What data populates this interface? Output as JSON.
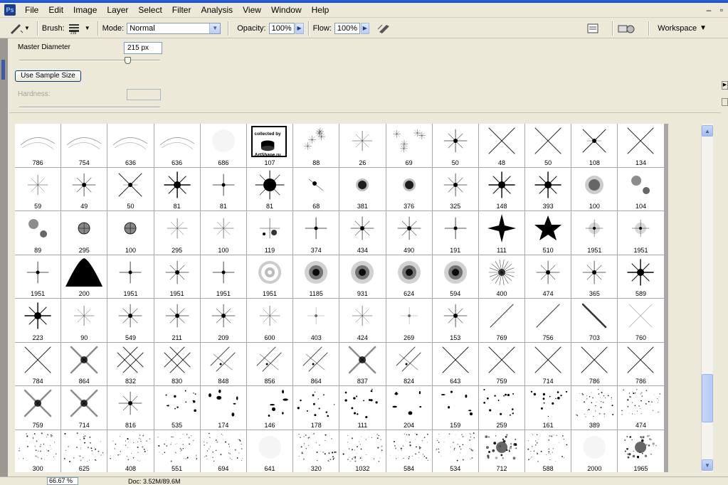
{
  "menu": {
    "items": [
      "File",
      "Edit",
      "Image",
      "Layer",
      "Select",
      "Filter",
      "Analysis",
      "View",
      "Window",
      "Help"
    ]
  },
  "window_controls": {
    "minimize": "–",
    "restore": "▫"
  },
  "options": {
    "brush_label": "Brush:",
    "mode_label": "Mode:",
    "mode_value": "Normal",
    "opacity_label": "Opacity:",
    "opacity_value": "100%",
    "flow_label": "Flow:",
    "flow_value": "100%",
    "workspace_label": "Workspace"
  },
  "panel": {
    "master_diameter_label": "Master Diameter",
    "master_diameter_value": "215 px",
    "master_diameter_slider": 0.77,
    "sample_button": "Use Sample Size",
    "hardness_label": "Hardness:",
    "badge_text": "collected by ArtShape.ru"
  },
  "brushes": [
    {
      "n": "786",
      "k": "wisp"
    },
    {
      "n": "754",
      "k": "wisp"
    },
    {
      "n": "636",
      "k": "wisp"
    },
    {
      "n": "636",
      "k": "wisp"
    },
    {
      "n": "686",
      "k": "faint"
    },
    {
      "n": "107",
      "k": "badge"
    },
    {
      "n": "88",
      "k": "multistar"
    },
    {
      "n": "26",
      "k": "thinstar"
    },
    {
      "n": "69",
      "k": "multistar"
    },
    {
      "n": "50",
      "k": "star"
    },
    {
      "n": "48",
      "k": "x"
    },
    {
      "n": "50",
      "k": "x"
    },
    {
      "n": "108",
      "k": "xstar"
    },
    {
      "n": "134",
      "k": "x"
    },
    {
      "n": "59",
      "k": "thinstar"
    },
    {
      "n": "49",
      "k": "star"
    },
    {
      "n": "50",
      "k": "xstar"
    },
    {
      "n": "81",
      "k": "boldstar"
    },
    {
      "n": "81",
      "k": "star4"
    },
    {
      "n": "81",
      "k": "burst"
    },
    {
      "n": "68",
      "k": "comet"
    },
    {
      "n": "381",
      "k": "glow"
    },
    {
      "n": "376",
      "k": "glow"
    },
    {
      "n": "325",
      "k": "star"
    },
    {
      "n": "148",
      "k": "boldstar"
    },
    {
      "n": "393",
      "k": "boldstar"
    },
    {
      "n": "100",
      "k": "softglow"
    },
    {
      "n": "104",
      "k": "twoglow"
    },
    {
      "n": "89",
      "k": "twoglow"
    },
    {
      "n": "295",
      "k": "circle"
    },
    {
      "n": "100",
      "k": "circle"
    },
    {
      "n": "295",
      "k": "thinstar"
    },
    {
      "n": "100",
      "k": "thinstar"
    },
    {
      "n": "119",
      "k": "clusterstar"
    },
    {
      "n": "374",
      "k": "star4"
    },
    {
      "n": "434",
      "k": "star"
    },
    {
      "n": "490",
      "k": "star"
    },
    {
      "n": "191",
      "k": "star4"
    },
    {
      "n": "111",
      "k": "fourpoint"
    },
    {
      "n": "510",
      "k": "pentagram"
    },
    {
      "n": "1951",
      "k": "ringstar"
    },
    {
      "n": "1951",
      "k": "ringstar"
    },
    {
      "n": "1951",
      "k": "star4"
    },
    {
      "n": "200",
      "k": "bell"
    },
    {
      "n": "1951",
      "k": "star4"
    },
    {
      "n": "1951",
      "k": "star"
    },
    {
      "n": "1951",
      "k": "star4"
    },
    {
      "n": "1951",
      "k": "ring"
    },
    {
      "n": "1185",
      "k": "fuzzy"
    },
    {
      "n": "931",
      "k": "fuzzy"
    },
    {
      "n": "624",
      "k": "fuzzy"
    },
    {
      "n": "594",
      "k": "fuzzy"
    },
    {
      "n": "400",
      "k": "spiky"
    },
    {
      "n": "474",
      "k": "star"
    },
    {
      "n": "365",
      "k": "star"
    },
    {
      "n": "589",
      "k": "boldstar"
    },
    {
      "n": "223",
      "k": "boldstar"
    },
    {
      "n": "90",
      "k": "thinstar"
    },
    {
      "n": "549",
      "k": "star"
    },
    {
      "n": "211",
      "k": "star"
    },
    {
      "n": "209",
      "k": "star"
    },
    {
      "n": "600",
      "k": "thinstar"
    },
    {
      "n": "403",
      "k": "faintstar"
    },
    {
      "n": "424",
      "k": "thinstar"
    },
    {
      "n": "269",
      "k": "faintstar"
    },
    {
      "n": "153",
      "k": "star"
    },
    {
      "n": "769",
      "k": "slash"
    },
    {
      "n": "756",
      "k": "slash"
    },
    {
      "n": "703",
      "k": "bslash"
    },
    {
      "n": "760",
      "k": "faintx"
    },
    {
      "n": "784",
      "k": "x"
    },
    {
      "n": "864",
      "k": "fuzzyx"
    },
    {
      "n": "832",
      "k": "hashx"
    },
    {
      "n": "830",
      "k": "hashx"
    },
    {
      "n": "848",
      "k": "hash"
    },
    {
      "n": "856",
      "k": "hash"
    },
    {
      "n": "864",
      "k": "hash"
    },
    {
      "n": "837",
      "k": "fuzzyx"
    },
    {
      "n": "824",
      "k": "hash"
    },
    {
      "n": "643",
      "k": "x"
    },
    {
      "n": "759",
      "k": "x"
    },
    {
      "n": "714",
      "k": "x"
    },
    {
      "n": "786",
      "k": "x"
    },
    {
      "n": "786",
      "k": "x"
    },
    {
      "n": "759",
      "k": "fuzzyx"
    },
    {
      "n": "714",
      "k": "fuzzyx"
    },
    {
      "n": "816",
      "k": "star"
    },
    {
      "n": "535",
      "k": "dots"
    },
    {
      "n": "174",
      "k": "splats"
    },
    {
      "n": "146",
      "k": "splats"
    },
    {
      "n": "178",
      "k": "dots"
    },
    {
      "n": "111",
      "k": "dots"
    },
    {
      "n": "204",
      "k": "splats"
    },
    {
      "n": "159",
      "k": "splats"
    },
    {
      "n": "259",
      "k": "dots"
    },
    {
      "n": "161",
      "k": "dots"
    },
    {
      "n": "389",
      "k": "speckle"
    },
    {
      "n": "474",
      "k": "speckle"
    },
    {
      "n": "300",
      "k": "speckle"
    },
    {
      "n": "625",
      "k": "speckle"
    },
    {
      "n": "408",
      "k": "speckle"
    },
    {
      "n": "551",
      "k": "speckle"
    },
    {
      "n": "694",
      "k": "speckle"
    },
    {
      "n": "641",
      "k": "faint"
    },
    {
      "n": "320",
      "k": "speckle"
    },
    {
      "n": "1032",
      "k": "speckle"
    },
    {
      "n": "584",
      "k": "speckle"
    },
    {
      "n": "534",
      "k": "speckle"
    },
    {
      "n": "712",
      "k": "bigsplat"
    },
    {
      "n": "588",
      "k": "speckle"
    },
    {
      "n": "2000",
      "k": "faint"
    },
    {
      "n": "1965",
      "k": "bigsplat"
    }
  ],
  "status": {
    "zoom": "66.67 %",
    "doc": "Doc: 3.52M/89.6M"
  },
  "colors": {
    "accent": "#1d3f8a",
    "scroll": "#b4c9f7"
  }
}
